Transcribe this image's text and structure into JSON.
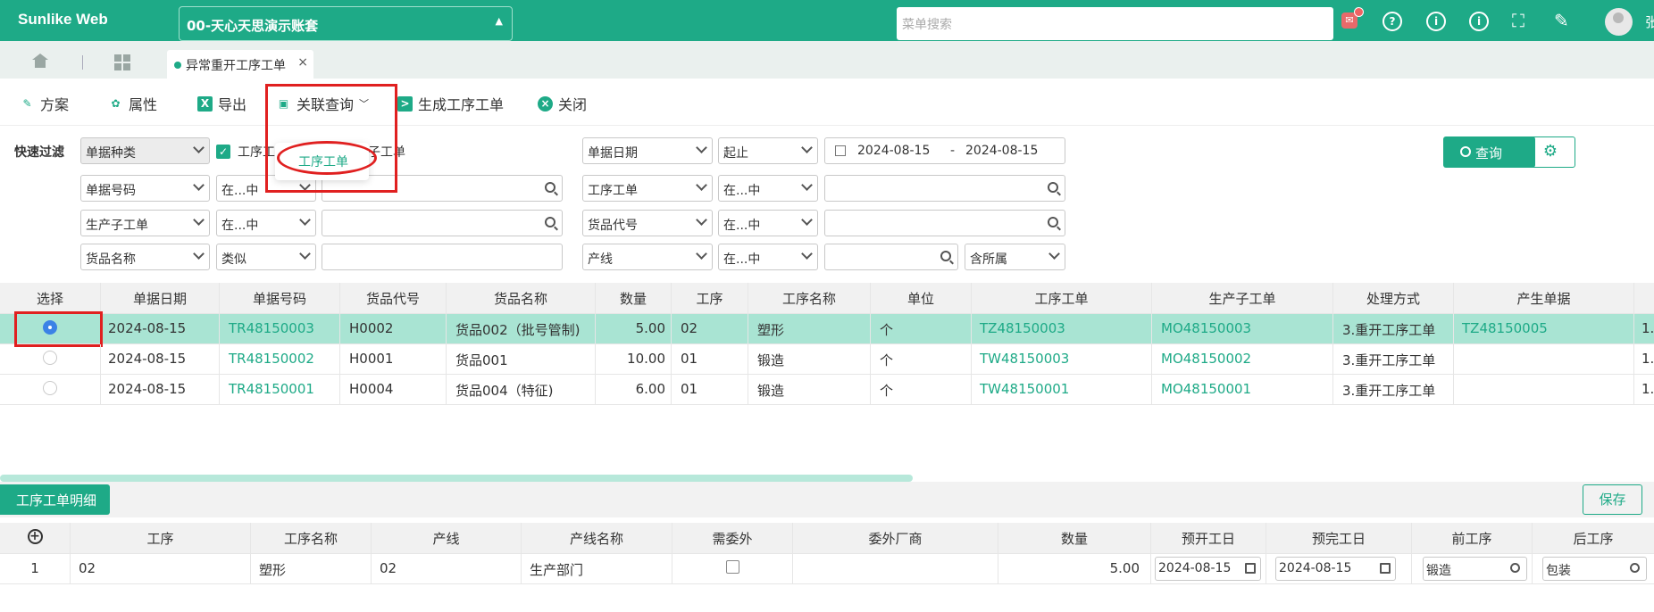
{
  "app": {
    "brand": "Sunlike Web",
    "account": "00-天心天思演示账套",
    "search_placeholder": "菜单搜索",
    "user": "张"
  },
  "tabs": [
    {
      "label": "异常重开工序工单"
    }
  ],
  "toolbar": {
    "plan": "方案",
    "attr": "属性",
    "export": "导出",
    "related": "关联查询",
    "generate": "生成工序工单",
    "close": "关闭"
  },
  "dropdown": {
    "item": "工序工单"
  },
  "filter": {
    "quick_label": "快速过滤",
    "r1": {
      "f1": "单据种类",
      "chk_label_a": "工序工",
      "chk_label_b": "子工单",
      "f2": "单据日期",
      "op2": "起止",
      "date_from": "2024-08-15",
      "date_dash": "-",
      "date_to": "2024-08-15"
    },
    "r2": {
      "f1": "单据号码",
      "op1": "在...中",
      "f2": "工序工单",
      "op2": "在...中"
    },
    "r3": {
      "f1": "生产子工单",
      "op1": "在...中",
      "f2": "货品代号",
      "op2": "在...中"
    },
    "r4": {
      "f1": "货品名称",
      "op1": "类似",
      "f2": "产线",
      "op2": "在...中",
      "op3": "含所属"
    },
    "query_btn": "查询"
  },
  "main_table": {
    "headers": [
      "选择",
      "单据日期",
      "单据号码",
      "货品代号",
      "货品名称",
      "数量",
      "工序",
      "工序名称",
      "单位",
      "工序工单",
      "生产子工单",
      "处理方式",
      "产生单据"
    ],
    "rows": [
      {
        "date": "2024-08-15",
        "no": "TR48150003",
        "code": "H0002",
        "name": "货品002（批号管制)",
        "qty": "5.00",
        "proc": "02",
        "proc_name": "塑形",
        "unit": "个",
        "wo": "TZ48150003",
        "mo": "MO48150003",
        "method": "3.重开工序工单",
        "gen": "TZ48150005",
        "tail": "1."
      },
      {
        "date": "2024-08-15",
        "no": "TR48150002",
        "code": "H0001",
        "name": "货品001",
        "qty": "10.00",
        "proc": "01",
        "proc_name": "锻造",
        "unit": "个",
        "wo": "TW48150003",
        "mo": "MO48150002",
        "method": "3.重开工序工单",
        "gen": "",
        "tail": "1."
      },
      {
        "date": "2024-08-15",
        "no": "TR48150001",
        "code": "H0004",
        "name": "货品004（特征)",
        "qty": "6.00",
        "proc": "01",
        "proc_name": "锻造",
        "unit": "个",
        "wo": "TW48150001",
        "mo": "MO48150001",
        "method": "3.重开工序工单",
        "gen": "",
        "tail": "1."
      }
    ]
  },
  "detail": {
    "tab_label": "工序工单明细",
    "save": "保存",
    "headers": [
      "工序",
      "工序名称",
      "产线",
      "产线名称",
      "需委外",
      "委外厂商",
      "数量",
      "预开工日",
      "预完工日",
      "前工序",
      "后工序"
    ],
    "rows": [
      {
        "idx": "1",
        "proc": "02",
        "proc_name": "塑形",
        "line": "02",
        "line_name": "生产部门",
        "qty": "5.00",
        "start": "2024-08-15",
        "end": "2024-08-15",
        "prev": "锻造",
        "next": "包装"
      }
    ]
  },
  "colors": {
    "primary": "#1eaa87",
    "highlight_row": "#a9e4d3",
    "annotation": "#e02020"
  }
}
